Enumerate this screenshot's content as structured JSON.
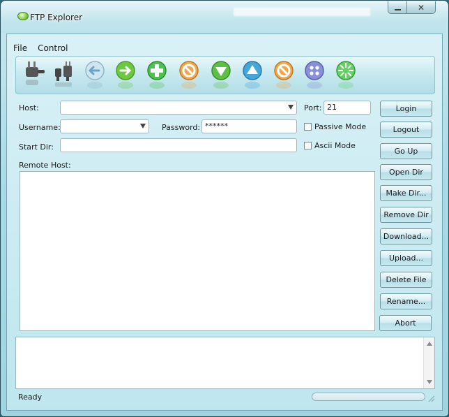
{
  "window": {
    "title": "FTP Explorer",
    "close_glyph": "✕"
  },
  "menu": [
    {
      "label": "File"
    },
    {
      "label": "Control"
    }
  ],
  "toolbar": {
    "icons": [
      {
        "name": "connect-plug-icon",
        "color": "#4a4a4a"
      },
      {
        "name": "disconnect-plug-icon",
        "color": "#4a4a4a"
      },
      {
        "name": "back-arrow-icon",
        "color": "#6aa5c7"
      },
      {
        "name": "forward-arrow-icon",
        "color": "#5fbf38"
      },
      {
        "name": "add-icon",
        "color": "#45b845"
      },
      {
        "name": "stop-icon",
        "color": "#e59a3c"
      },
      {
        "name": "download-icon",
        "color": "#56b844"
      },
      {
        "name": "upload-icon",
        "color": "#3f9ed1"
      },
      {
        "name": "cancel-icon",
        "color": "#e59a3c"
      },
      {
        "name": "options-icon",
        "color": "#7b85d0"
      },
      {
        "name": "refresh-burst-icon",
        "color": "#5ccb5c"
      }
    ]
  },
  "form": {
    "host_label": "Host:",
    "host_value": "",
    "port_label": "Port:",
    "port_value": "21",
    "username_label": "Username:",
    "username_value": "",
    "password_label": "Password:",
    "password_value": "******",
    "passive_label": "Passive Mode",
    "passive_checked": false,
    "startdir_label": "Start Dir:",
    "startdir_value": "",
    "ascii_label": "Ascii Mode",
    "ascii_checked": false,
    "remote_label": "Remote Host:"
  },
  "buttons": {
    "login": "Login",
    "logout": "Logout",
    "go_up": "Go Up",
    "open_dir": "Open Dir",
    "make_dir": "Make Dir...",
    "remove_dir": "Remove Dir",
    "download": "Download...",
    "upload": "Upload...",
    "delete_file": "Delete File",
    "rename": "Rename...",
    "abort": "Abort"
  },
  "status": {
    "text": "Ready",
    "progress": 0
  }
}
